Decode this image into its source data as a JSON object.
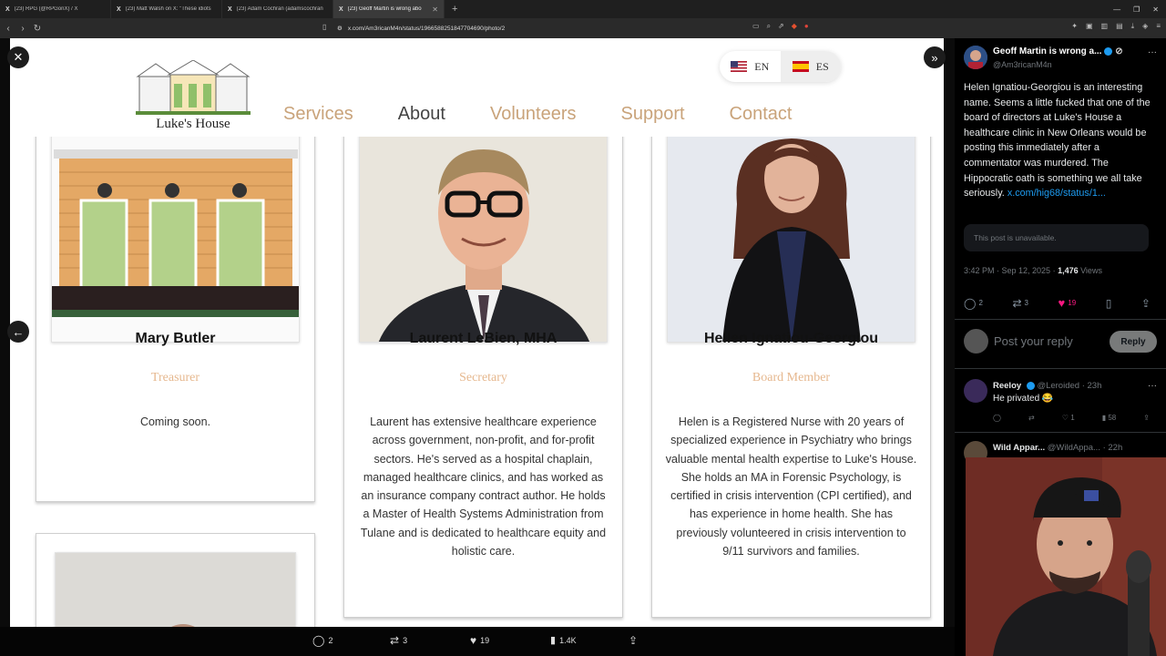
{
  "browser": {
    "tabs": [
      {
        "label": "(23) RPG (@RPGonX) / X",
        "active": false
      },
      {
        "label": "(23) Matt Walsh on X: \"These idiots",
        "active": false
      },
      {
        "label": "(23) Adam Cochran (adamscochran",
        "active": false
      },
      {
        "label": "(23) Geoff Martin is wrong abo",
        "active": true
      }
    ],
    "url": "x.com/Am3ricanM4n/status/1966588251847704690/photo/2"
  },
  "site": {
    "logo_text": "Luke's House",
    "nav": [
      "Services",
      "About",
      "Volunteers",
      "Support",
      "Contact"
    ],
    "current_nav": "About",
    "lang": {
      "en": "EN",
      "es": "ES"
    },
    "members": [
      {
        "name": "Mary Butler",
        "role": "Treasurer",
        "bio": "Coming soon."
      },
      {
        "name": "Laurent LeBien, MHA",
        "role": "Secretary",
        "bio": "Laurent has extensive healthcare experience across government, non-profit, and for-profit sectors. He's served as a hospital chaplain, managed healthcare clinics, and has worked as an insurance company contract author. He holds a Master of Health Systems Administration from Tulane and is dedicated to healthcare equity and holistic care."
      },
      {
        "name": "Hellen Ignatiou-Georgiou",
        "role": "Board Member",
        "bio": "Helen is a Registered Nurse with 20 years of specialized experience in Psychiatry who brings valuable mental health expertise to Luke's House. She holds an MA in Forensic Psychology, is certified in crisis intervention (CPI certified), and has experience in home health. She has previously volunteered in crisis intervention to 9/11 survivors and families."
      }
    ]
  },
  "viewer_bar": {
    "replies": "2",
    "reposts": "3",
    "likes": "19",
    "views": "1.4K"
  },
  "post": {
    "author_name": "Geoff Martin is wrong a...",
    "handle": "@Am3ricanM4n",
    "text": "Helen Ignatiou-Georgiou is an interesting name. Seems a little fucked that one of the board of directors at Luke's House a healthcare clinic in New Orleans would be posting this immediately after a commentator was murdered. The Hippocratic oath is something we all take seriously.",
    "link": "x.com/hig68/status/1...",
    "unavailable": "This post is unavailable.",
    "time": "3:42 PM · Sep 12, 2025 · ",
    "views_count": "1,476",
    "views_label": " Views",
    "replies": "2",
    "reposts": "3",
    "likes": "19",
    "reply_placeholder": "Post your reply",
    "reply_button": "Reply"
  },
  "comments": [
    {
      "name": "Reeloy",
      "handle": "@Leroided · 23h",
      "text": "He privated 😂",
      "likes": "1",
      "views": "58"
    },
    {
      "name": "Wild Appar...",
      "handle": "@WildAppa... · 22h"
    }
  ],
  "colors": {
    "accent_gold": "#c9a37a",
    "role_peach": "#e6b88f",
    "x_blue": "#1d9bf0",
    "like_pink": "#f91880"
  }
}
